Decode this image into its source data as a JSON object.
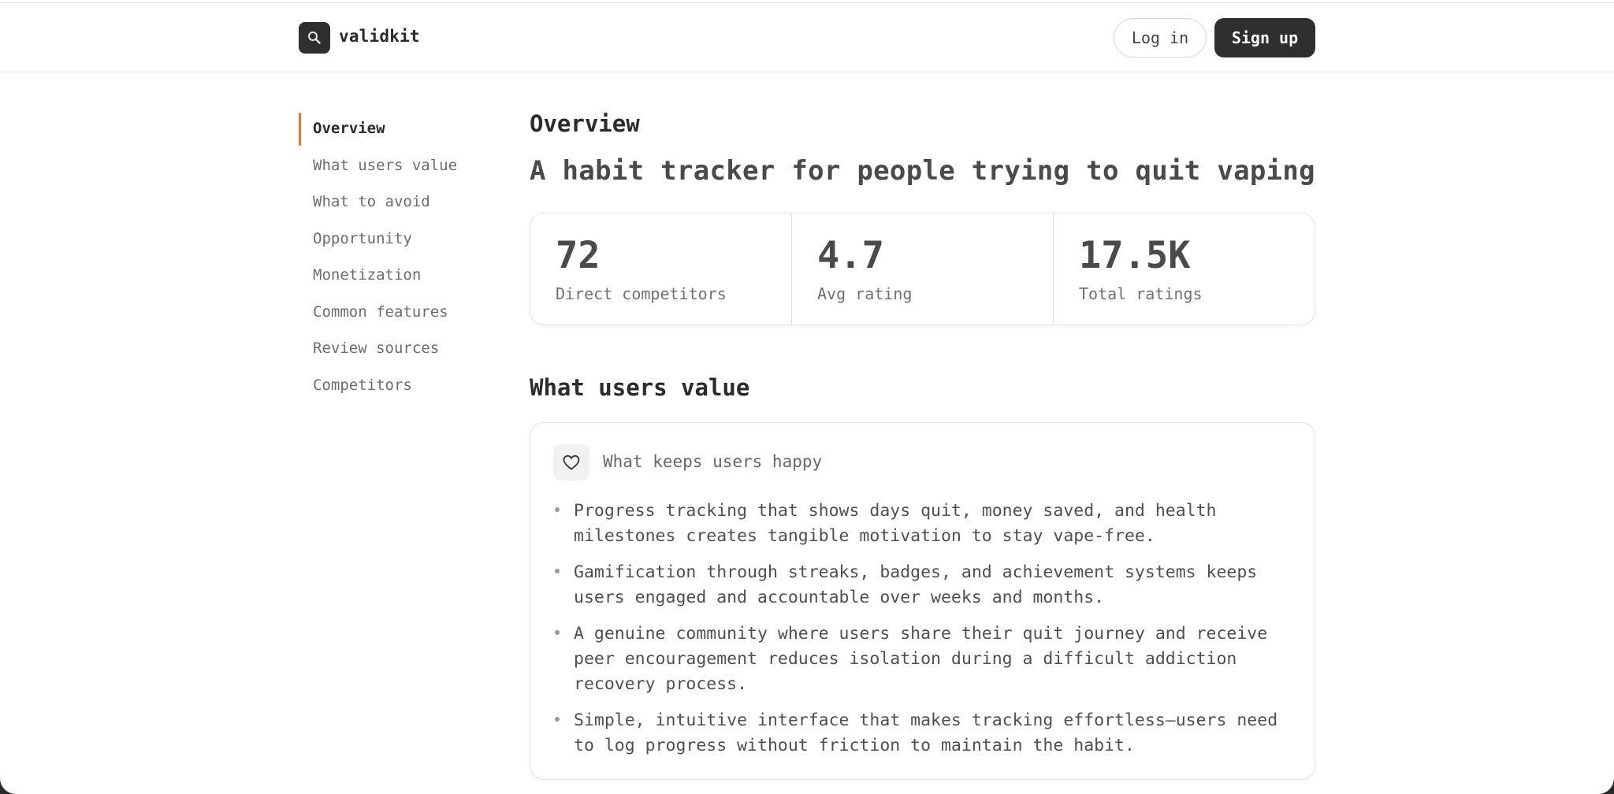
{
  "header": {
    "brand": "validkit",
    "login_label": "Log in",
    "signup_label": "Sign up"
  },
  "nav": {
    "items": [
      {
        "label": "Overview"
      },
      {
        "label": "What users value"
      },
      {
        "label": "What to avoid"
      },
      {
        "label": "Opportunity"
      },
      {
        "label": "Monetization"
      },
      {
        "label": "Common features"
      },
      {
        "label": "Review sources"
      },
      {
        "label": "Competitors"
      }
    ]
  },
  "overview": {
    "title": "Overview",
    "headline": "A habit tracker for people trying to quit vaping",
    "stats": [
      {
        "value": "72",
        "label": "Direct competitors"
      },
      {
        "value": "4.7",
        "label": "Avg rating"
      },
      {
        "value": "17.5K",
        "label": "Total ratings"
      }
    ]
  },
  "users_value": {
    "title": "What users value",
    "card_title": "What keeps users happy",
    "icon": "heart-icon",
    "items": [
      "Progress tracking that shows days quit, money saved, and health milestones creates tangible motivation to stay vape-free.",
      "Gamification through streaks, badges, and achievement systems keeps users engaged and accountable over weeks and months.",
      "A genuine community where users share their quit journey and receive peer encouragement reduces isolation during a difficult addiction recovery process.",
      "Simple, intuitive interface that makes tracking effortless—users need to log progress without friction to maintain the habit."
    ]
  },
  "colors": {
    "accent": "#e07a2c",
    "dark": "#2f2f2f",
    "border": "#e3e3e3"
  }
}
